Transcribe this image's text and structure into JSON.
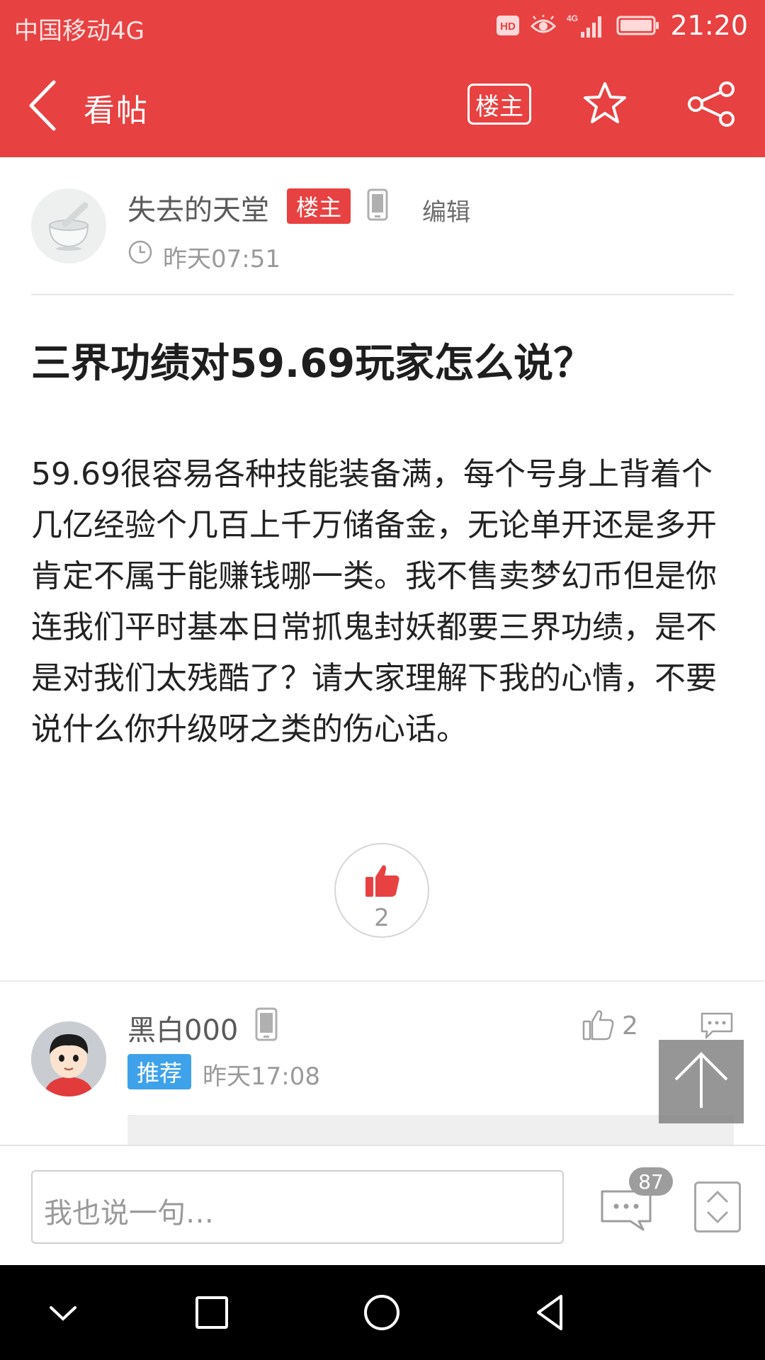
{
  "status_bar": {
    "carrier": "中国移动4G",
    "hd_label": "HD",
    "network_label": "4G",
    "time": "21:20"
  },
  "title_bar": {
    "title": "看帖",
    "owner_only_label": "楼主"
  },
  "post": {
    "author": "失去的天堂",
    "owner_badge": "楼主",
    "edit_label": "编辑",
    "time": "昨天07:51",
    "title": "三界功绩对59.69玩家怎么说？",
    "body": "59.69很容易各种技能装备满，每个号身上背着个几亿经验个几百上千万储备金，无论单开还是多开肯定不属于能赚钱哪一类。我不售卖梦幻币但是你连我们平时基本日常抓鬼封妖都要三界功绩，是不是对我们太残酷了？请大家理解下我的心情，不要说什么你升级呀之类的伤心话。",
    "like_count": "2"
  },
  "reply": {
    "author": "黑白000",
    "badge": "推荐",
    "time": "昨天17:08",
    "like_count": "2"
  },
  "input_bar": {
    "placeholder": "我也说一句…",
    "comment_count": "87"
  },
  "colors": {
    "brand": "#e84141",
    "recommend": "#3ea2ea"
  }
}
